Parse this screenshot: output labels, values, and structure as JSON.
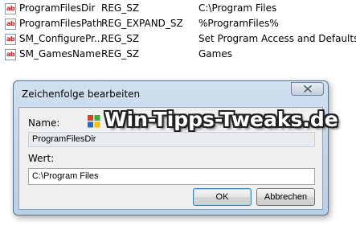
{
  "registry": {
    "rows": [
      {
        "icon_text": "ab",
        "name": "ProgramFilesDir",
        "type": "REG_SZ",
        "data": "C:\\Program Files"
      },
      {
        "icon_text": "ab",
        "name": "ProgramFilesPath",
        "type": "REG_EXPAND_SZ",
        "data": "%ProgramFiles%"
      },
      {
        "icon_text": "ab",
        "name": "SM_ConfigurePr...",
        "type": "REG_SZ",
        "data": "Set Program Access and Defaults"
      },
      {
        "icon_text": "ab",
        "name": "SM_GamesName",
        "type": "REG_SZ",
        "data": "Games"
      }
    ]
  },
  "dialog": {
    "title": "Zeichenfolge bearbeiten",
    "name_label": "Name:",
    "name_value": "ProgramFilesDir",
    "value_label": "Wert:",
    "value_value": "C:\\Program Files",
    "ok_label": "OK",
    "cancel_label": "Abbrechen",
    "watermark": "Win-Tipps-Tweaks.de"
  },
  "colors": {
    "dialog_frame": "#b9cfe6",
    "icon_text": "#cc1a1a"
  },
  "icons": {
    "registry_value": "string-value-icon",
    "close": "close-icon",
    "logo": "windows-logo-icon"
  }
}
